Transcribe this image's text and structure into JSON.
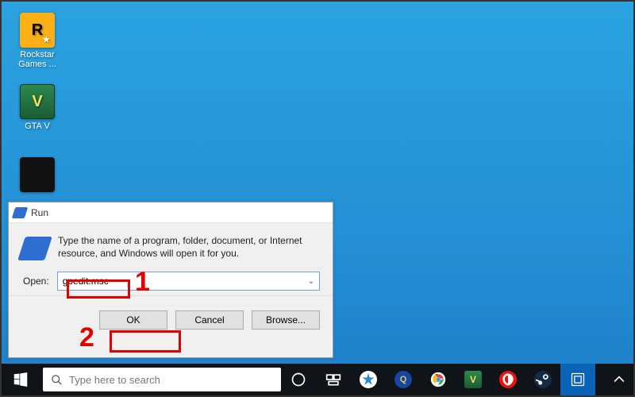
{
  "desktop": {
    "icons": [
      {
        "label": "Rockstar Games ...",
        "glyph": "R"
      },
      {
        "label": "GTA V",
        "glyph": "V"
      },
      {
        "label": "",
        "glyph": ""
      }
    ]
  },
  "run_dialog": {
    "title": "Run",
    "description": "Type the name of a program, folder, document, or Internet resource, and Windows will open it for you.",
    "open_label": "Open:",
    "open_value": "gpedit.msc",
    "buttons": {
      "ok": "OK",
      "cancel": "Cancel",
      "browse": "Browse..."
    }
  },
  "annotations": {
    "step1": "1",
    "step2": "2"
  },
  "taskbar": {
    "search_placeholder": "Type here to search",
    "apps": [
      {
        "name": "task-view"
      },
      {
        "name": "genshin"
      },
      {
        "name": "lien-quan"
      },
      {
        "name": "chrome"
      },
      {
        "name": "gta-v"
      },
      {
        "name": "garena"
      },
      {
        "name": "steam"
      },
      {
        "name": "settings"
      }
    ],
    "tray": {}
  }
}
